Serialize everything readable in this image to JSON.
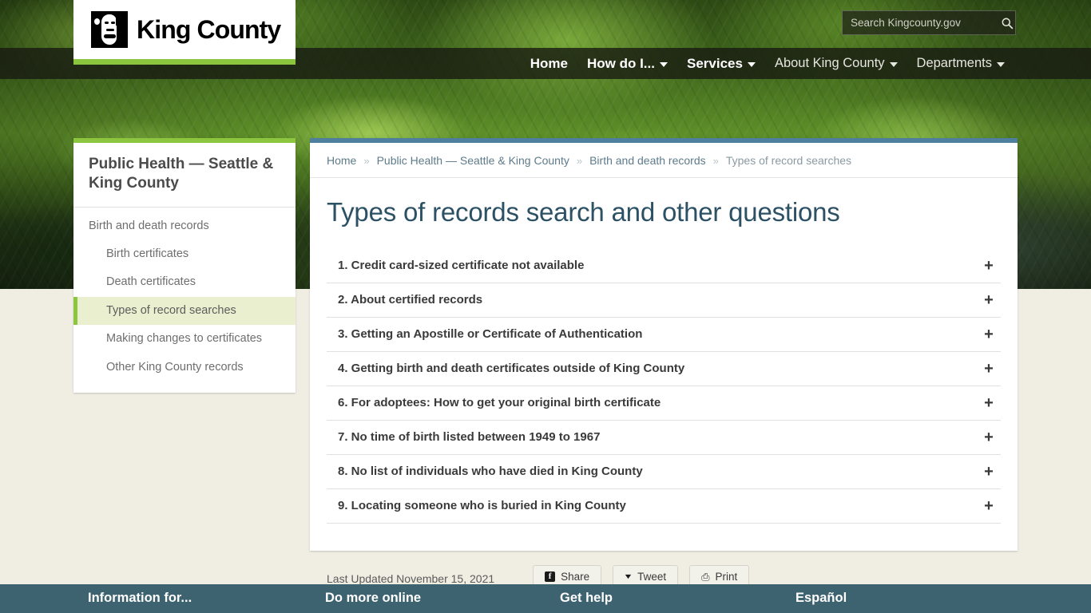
{
  "site": {
    "logo_text": "King County",
    "logo_mark": "mlk-face-icon"
  },
  "search": {
    "placeholder": "Search Kingcounty.gov",
    "value": "",
    "icon": "search-icon"
  },
  "topnav": {
    "items": [
      {
        "label": "Home",
        "has_caret": false,
        "style": "bold"
      },
      {
        "label": "How do I...",
        "has_caret": true,
        "style": "bold"
      },
      {
        "label": "Services",
        "has_caret": true,
        "style": "bold"
      },
      {
        "label": "About King County",
        "has_caret": true,
        "style": "dim"
      },
      {
        "label": "Departments",
        "has_caret": true,
        "style": "dim"
      }
    ]
  },
  "sidebar": {
    "title": "Public Health — Seattle & King County",
    "accent_color": "#8cc63e",
    "items": [
      {
        "label": "Birth and death records",
        "level": 0,
        "active": false
      },
      {
        "label": "Birth certificates",
        "level": 1,
        "active": false
      },
      {
        "label": "Death certificates",
        "level": 1,
        "active": false
      },
      {
        "label": "Types of record searches",
        "level": 1,
        "active": true
      },
      {
        "label": "Making changes to certificates",
        "level": 1,
        "active": false
      },
      {
        "label": "Other King County records",
        "level": 1,
        "active": false
      }
    ]
  },
  "breadcrumb": {
    "separator": "»",
    "items": [
      {
        "label": "Home",
        "current": false
      },
      {
        "label": "Public Health — Seattle & King County",
        "current": false
      },
      {
        "label": "Birth and death records",
        "current": false
      },
      {
        "label": "Types of record searches",
        "current": true
      }
    ]
  },
  "main": {
    "title": "Types of records search and other questions",
    "accent_color": "#4e7f9e",
    "accordion": [
      {
        "label": "1. Credit card-sized certificate not available",
        "expanded": false,
        "toggle": "+"
      },
      {
        "label": "2. About certified records",
        "expanded": false,
        "toggle": "+"
      },
      {
        "label": "3. Getting an Apostille or Certificate of Authentication",
        "expanded": false,
        "toggle": "+"
      },
      {
        "label": "4. Getting birth and death certificates outside of King County",
        "expanded": false,
        "toggle": "+"
      },
      {
        "label": "6. For adoptees: How to get your original birth certificate",
        "expanded": false,
        "toggle": "+"
      },
      {
        "label": "7. No time of birth listed between 1949 to 1967",
        "expanded": false,
        "toggle": "+"
      },
      {
        "label": "8. No list of individuals who have died in King County",
        "expanded": false,
        "toggle": "+"
      },
      {
        "label": "9. Locating someone who is buried in King County",
        "expanded": false,
        "toggle": "+"
      }
    ]
  },
  "meta": {
    "last_updated": "Last Updated November 15, 2021",
    "share_buttons": [
      {
        "label": "Share",
        "icon": "facebook-icon"
      },
      {
        "label": "Tweet",
        "icon": "twitter-icon"
      },
      {
        "label": "Print",
        "icon": "printer-icon"
      }
    ]
  },
  "footer": {
    "background_color": "#3e6370",
    "columns": [
      {
        "label": "Information for..."
      },
      {
        "label": "Do more online"
      },
      {
        "label": "Get help"
      },
      {
        "label": "Español"
      }
    ]
  }
}
